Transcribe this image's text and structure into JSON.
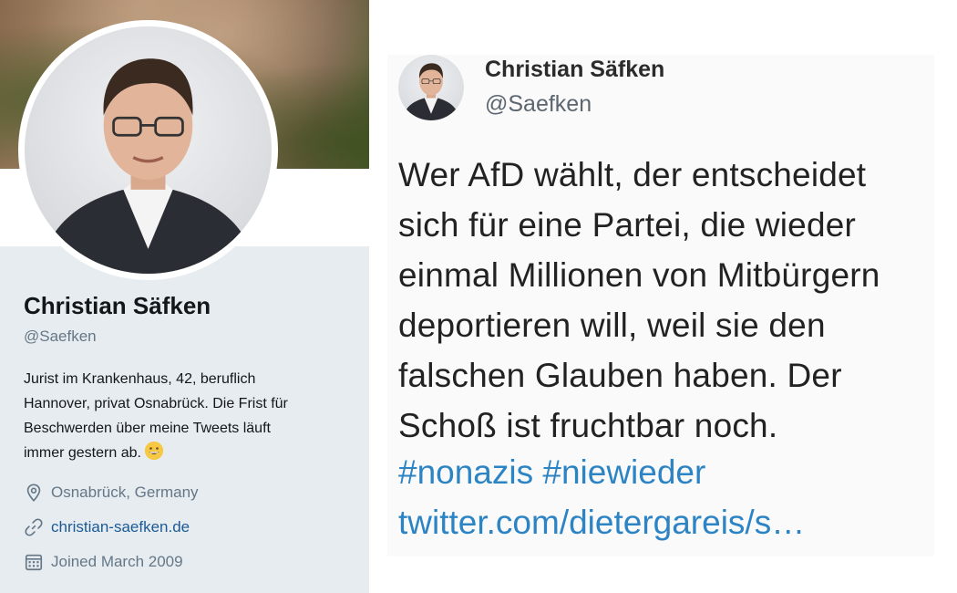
{
  "profile": {
    "name": "Christian Säfken",
    "handle": "@Saefken",
    "bio_lines": [
      "Jurist im Krankenhaus, 42, beruflich",
      "Hannover, privat Osnabrück. Die Frist für",
      "Beschwerden über meine Tweets läuft",
      "immer gestern ab."
    ],
    "bio_emoji": "grinning-face-emoji",
    "location": "Osnabrück, Germany",
    "website": "christian-saefken.de",
    "joined": "Joined March 2009",
    "icons": {
      "location": "location-pin-icon",
      "website": "link-icon",
      "joined": "calendar-icon"
    }
  },
  "tweet": {
    "author_name": "Christian Säfken",
    "author_handle": "@Saefken",
    "text_lines": [
      "Wer AfD wählt, der entscheidet",
      "sich für eine Partei, die wieder",
      "einmal Millionen von Mitbürgern",
      "deportieren will, weil sie den",
      "falschen Glauben haben. Der",
      "Schoß ist fruchtbar noch."
    ],
    "hashtags": "#nonazis #niewieder",
    "link": "twitter.com/dietergareis/s…"
  },
  "colors": {
    "panel_bg": "#e6ecf0",
    "secondary_text": "#657786",
    "link": "#1b5a95",
    "tweet_link": "#2c84c4"
  }
}
